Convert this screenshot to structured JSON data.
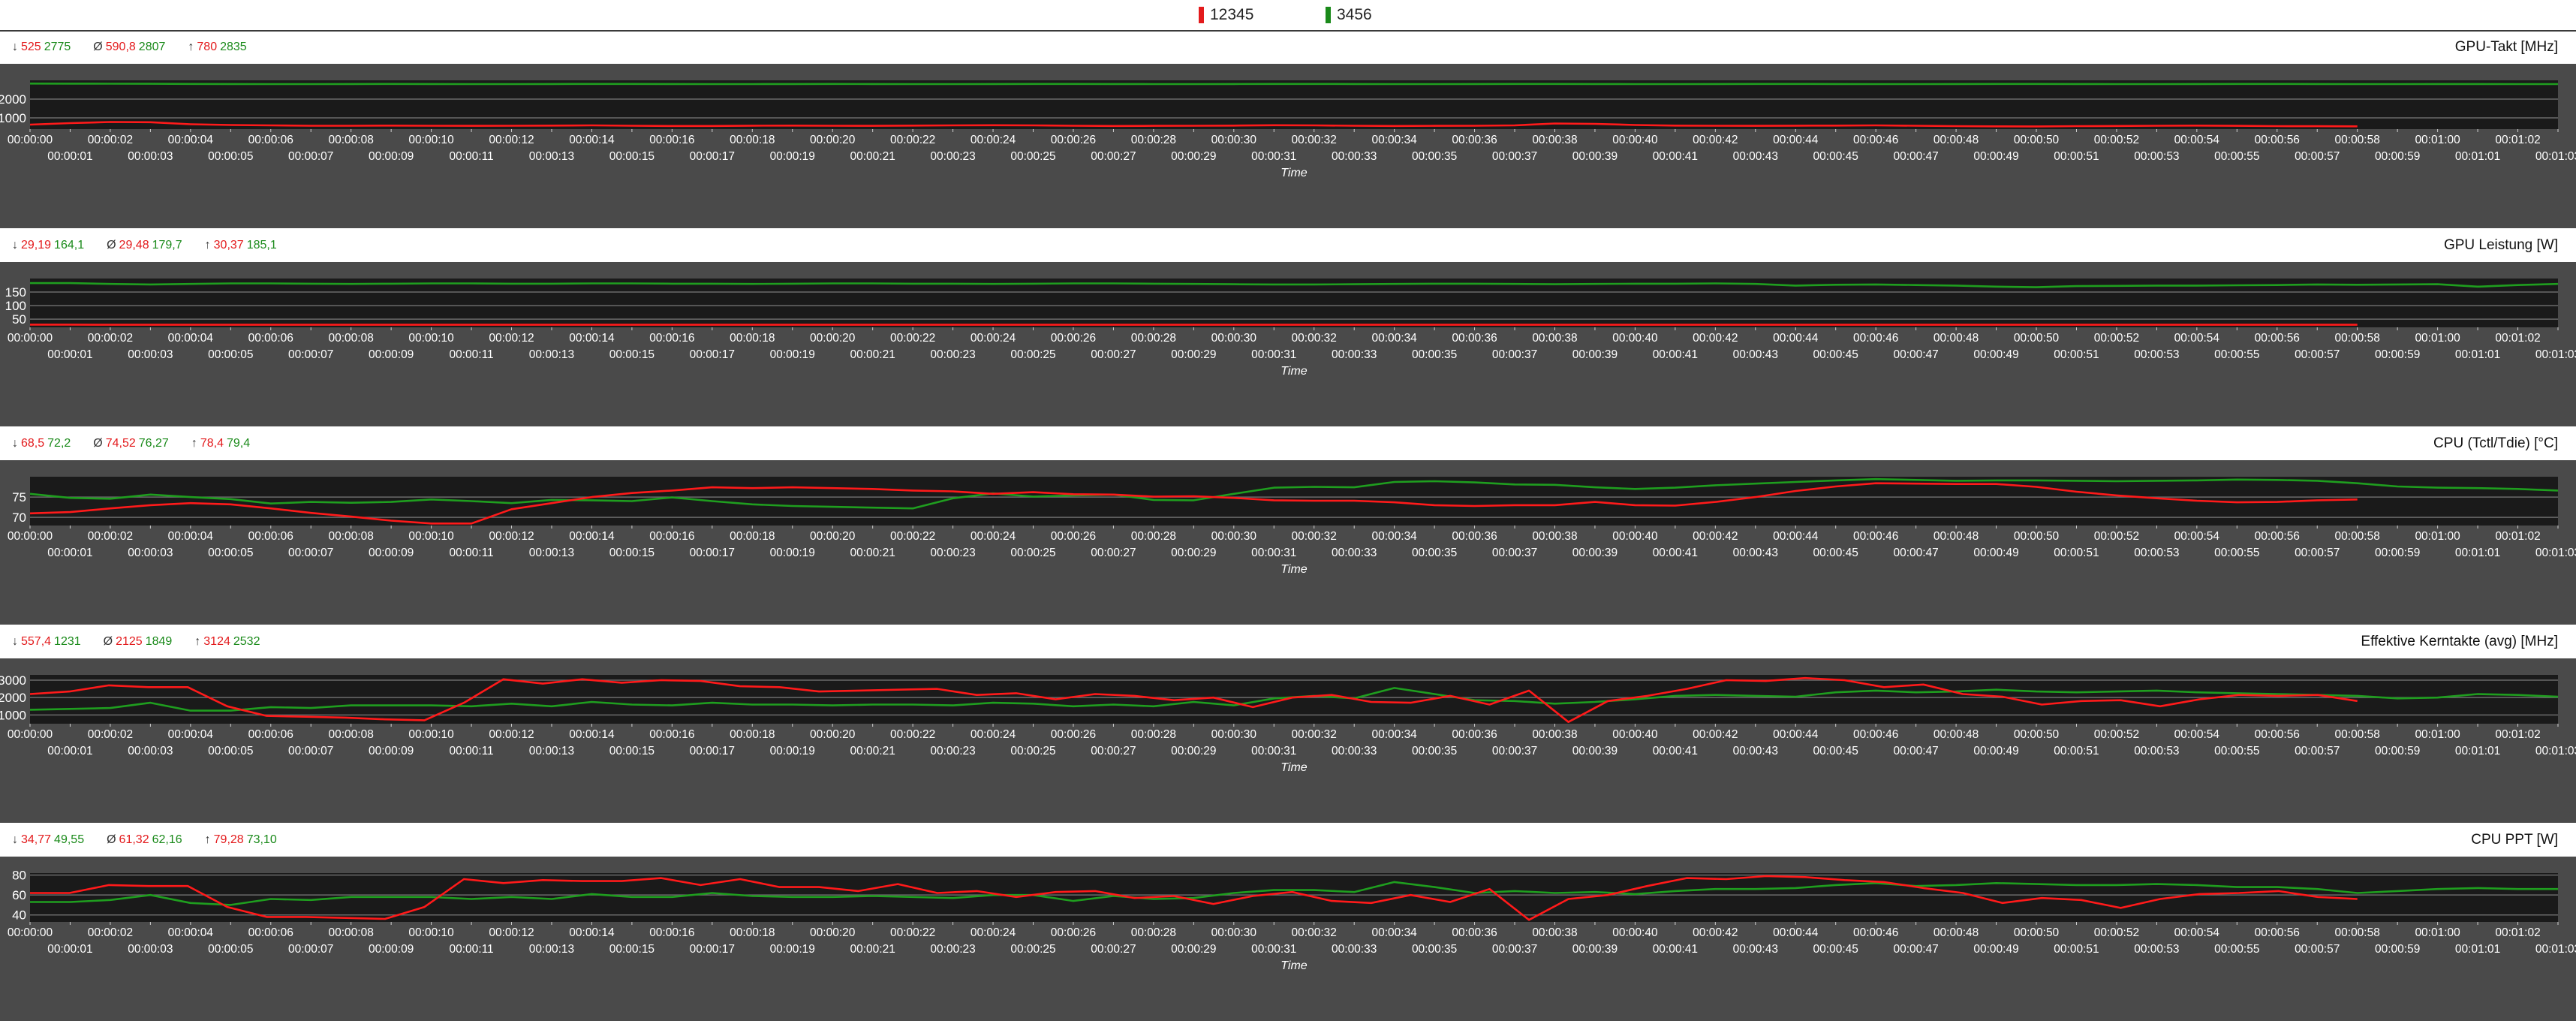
{
  "legend": [
    {
      "label": "12345",
      "color": "#e31a1c"
    },
    {
      "label": "3456",
      "color": "#1a8a1a"
    }
  ],
  "colors": {
    "red": "#ff1a1a",
    "green": "#1f9e1f",
    "plot_bg": "#1a1a1a",
    "frame": "#4a4a4a",
    "grid": "#6a6a6a"
  },
  "time_axis_label": "Time",
  "charts": [
    {
      "title": "GPU-Takt [MHz]",
      "stats": {
        "min": [
          "525",
          "2775"
        ],
        "avg": [
          "590,8",
          "2807"
        ],
        "max": [
          "780",
          "2835"
        ]
      },
      "chart_data": {
        "type": "line",
        "title": "GPU-Takt [MHz]",
        "xlabel": "Time",
        "ylabel": "",
        "ylim": [
          400,
          3000
        ],
        "yticks": [
          1000,
          2000
        ],
        "x_range_s": [
          0,
          63
        ],
        "grid": true,
        "series": [
          {
            "name": "12345",
            "end_s": 58,
            "values": [
              640,
              720,
              780,
              770,
              660,
              620,
              600,
              580,
              580,
              590,
              580,
              575,
              580,
              590,
              600,
              580,
              570,
              570,
              585,
              590,
              580,
              575,
              590,
              600,
              610,
              600,
              580,
              570,
              575,
              580,
              590,
              610,
              600,
              580,
              570,
              575,
              580,
              600,
              700,
              680,
              620,
              590,
              580,
              575,
              585,
              590,
              600,
              580,
              560,
              550,
              545,
              560,
              570,
              580,
              590,
              575,
              560,
              555,
              550
            ]
          },
          {
            "name": "3456",
            "end_s": 63,
            "values": [
              2830,
              2825,
              2820,
              2815,
              2810,
              2805,
              2800,
              2800,
              2805,
              2810,
              2805,
              2800,
              2800,
              2805,
              2810,
              2808,
              2805,
              2800,
              2800,
              2805,
              2810,
              2805,
              2800,
              2800,
              2805,
              2810,
              2808,
              2805,
              2800,
              2800,
              2805,
              2808,
              2810,
              2805,
              2800,
              2800,
              2805,
              2810,
              2810,
              2805,
              2800,
              2800,
              2805,
              2810,
              2808,
              2805,
              2800,
              2800,
              2805,
              2810,
              2808,
              2805,
              2800,
              2800,
              2805,
              2808,
              2810,
              2805,
              2800,
              2800,
              2805,
              2805,
              2800,
              2800
            ]
          }
        ]
      }
    },
    {
      "title": "GPU Leistung [W]",
      "stats": {
        "min": [
          "29,19",
          "164,1"
        ],
        "avg": [
          "29,48",
          "179,7"
        ],
        "max": [
          "30,37",
          "185,1"
        ]
      },
      "chart_data": {
        "type": "line",
        "title": "GPU Leistung [W]",
        "xlabel": "Time",
        "ylabel": "",
        "ylim": [
          20,
          200
        ],
        "yticks": [
          50,
          100,
          150
        ],
        "x_range_s": [
          0,
          63
        ],
        "grid": true,
        "series": [
          {
            "name": "12345",
            "end_s": 58,
            "values": [
              30,
              30,
              29.5,
              29.5,
              29.4,
              29.4,
              29.4,
              29.5,
              29.5,
              29.4,
              29.4,
              29.4,
              29.5,
              29.5,
              29.4,
              29.4,
              29.4,
              29.5,
              29.5,
              29.4,
              29.4,
              29.4,
              29.5,
              29.5,
              29.4,
              29.4,
              29.4,
              29.5,
              29.5,
              29.4,
              29.4,
              29.4,
              29.5,
              29.5,
              29.4,
              29.4,
              29.4,
              29.5,
              29.5,
              29.4,
              29.4,
              29.4,
              29.5,
              29.5,
              29.4,
              29.4,
              29.4,
              29.5,
              29.5,
              29.4,
              29.4,
              29.4,
              29.5,
              29.5,
              29.4,
              29.4,
              29.4,
              29.5,
              29.5
            ]
          },
          {
            "name": "3456",
            "end_s": 63,
            "values": [
              183,
              183,
              180,
              178,
              180,
              182,
              182,
              181,
              180,
              181,
              182,
              182,
              181,
              181,
              182,
              182,
              181,
              181,
              180,
              181,
              182,
              182,
              181,
              181,
              180,
              181,
              182,
              182,
              181,
              180,
              179,
              178,
              178,
              179,
              180,
              181,
              181,
              180,
              179,
              180,
              181,
              181,
              182,
              180,
              174,
              177,
              178,
              176,
              174,
              170,
              168,
              172,
              173,
              174,
              174,
              175,
              176,
              178,
              177,
              178,
              179,
              170,
              176,
              180
            ]
          }
        ]
      }
    },
    {
      "title": "CPU (Tctl/Tdie) [°C]",
      "stats": {
        "min": [
          "68,5",
          "72,2"
        ],
        "avg": [
          "74,52",
          "76,27"
        ],
        "max": [
          "78,4",
          "79,4"
        ]
      },
      "chart_data": {
        "type": "line",
        "title": "CPU (Tctl/Tdie) [°C]",
        "xlabel": "Time",
        "ylabel": "",
        "ylim": [
          68,
          80
        ],
        "yticks": [
          70,
          75
        ],
        "x_range_s": [
          0,
          63
        ],
        "grid": true,
        "series": [
          {
            "name": "12345",
            "end_s": 58,
            "values": [
              71,
              71.3,
              72.2,
              73,
              73.5,
              73.2,
              72.2,
              71.1,
              70.2,
              69.2,
              68.5,
              68.5,
              72,
              73.5,
              75,
              76,
              76.6,
              77.4,
              77.2,
              77.4,
              77.2,
              77,
              76.6,
              76.4,
              75.8,
              76.2,
              75.7,
              75.6,
              75.1,
              75.2,
              74.8,
              74.2,
              74.1,
              74.1,
              73.7,
              73,
              72.8,
              73,
              73,
              73.8,
              73,
              72.9,
              73.8,
              75,
              76.5,
              77.6,
              78.4,
              78.3,
              78.2,
              78.2,
              77.5,
              76.3,
              75.4,
              74.7,
              74.1,
              73.7,
              73.8,
              74.2,
              74.4
            ]
          },
          {
            "name": "3456",
            "end_s": 63,
            "values": [
              75.8,
              74.8,
              74.6,
              75.6,
              75,
              74.5,
              73.4,
              73.8,
              73.6,
              73.8,
              74.4,
              74,
              73.5,
              74.3,
              74.2,
              74,
              74.9,
              74,
              73.2,
              72.8,
              72.6,
              72.4,
              72.2,
              74.7,
              75.9,
              75.1,
              75.4,
              75.6,
              74.3,
              74.2,
              75.8,
              77.3,
              77.5,
              77.4,
              78.7,
              78.9,
              78.6,
              78.1,
              78,
              77.4,
              77,
              77.3,
              77.9,
              78.3,
              78.7,
              79.1,
              79.4,
              79.2,
              79,
              79.1,
              79.1,
              79,
              78.9,
              79,
              79.1,
              79.3,
              79.2,
              79,
              78.4,
              77.6,
              77.3,
              77.2,
              77,
              76.6
            ]
          }
        ]
      }
    },
    {
      "title": "Effektive Kerntakte (avg) [MHz]",
      "stats": {
        "min": [
          "557,4",
          "1231"
        ],
        "avg": [
          "2125",
          "1849"
        ],
        "max": [
          "3124",
          "2532"
        ]
      },
      "chart_data": {
        "type": "line",
        "title": "Effektive Kerntakte (avg) [MHz]",
        "xlabel": "Time",
        "ylabel": "",
        "ylim": [
          500,
          3300
        ],
        "yticks": [
          1000,
          2000,
          3000
        ],
        "x_range_s": [
          0,
          63
        ],
        "grid": true,
        "series": [
          {
            "name": "12345",
            "end_s": 58,
            "values": [
              2200,
              2350,
              2700,
              2600,
              2600,
              1500,
              950,
              900,
              850,
              750,
              700,
              1700,
              3050,
              2800,
              3050,
              2850,
              3000,
              2950,
              2650,
              2600,
              2350,
              2400,
              2450,
              2500,
              2150,
              2250,
              1900,
              2200,
              2100,
              1850,
              2000,
              1450,
              2000,
              2150,
              1750,
              1700,
              2100,
              1600,
              2400,
              600,
              1800,
              2100,
              2500,
              3000,
              2950,
              3120,
              3000,
              2600,
              2750,
              2200,
              2050,
              1600,
              1800,
              1850,
              1500,
              1900,
              2150,
              2100,
              2150,
              1800
            ]
          },
          {
            "name": "3456",
            "end_s": 63,
            "values": [
              1300,
              1350,
              1400,
              1700,
              1250,
              1250,
              1450,
              1400,
              1550,
              1550,
              1550,
              1500,
              1650,
              1500,
              1750,
              1600,
              1550,
              1700,
              1600,
              1600,
              1550,
              1600,
              1600,
              1550,
              1700,
              1650,
              1500,
              1600,
              1500,
              1750,
              1550,
              1950,
              2100,
              1950,
              2550,
              2200,
              1850,
              1800,
              1650,
              1750,
              1900,
              2100,
              2150,
              2100,
              2050,
              2300,
              2400,
              2300,
              2350,
              2450,
              2350,
              2300,
              2350,
              2400,
              2300,
              2250,
              2200,
              2150,
              2100,
              1950,
              2000,
              2200,
              2150,
              2050
            ]
          }
        ]
      }
    },
    {
      "title": "CPU PPT [W]",
      "stats": {
        "min": [
          "34,77",
          "49,55"
        ],
        "avg": [
          "61,32",
          "62,16"
        ],
        "max": [
          "79,28",
          "73,10"
        ]
      },
      "chart_data": {
        "type": "line",
        "title": "CPU PPT [W]",
        "xlabel": "Time",
        "ylabel": "",
        "ylim": [
          33,
          82
        ],
        "yticks": [
          40,
          60,
          80
        ],
        "x_range_s": [
          0,
          63
        ],
        "grid": true,
        "series": [
          {
            "name": "12345",
            "end_s": 58,
            "values": [
              62,
              62,
              70,
              69,
              69,
              48,
              38,
              38,
              37,
              36,
              48,
              76,
              72,
              75,
              74,
              74,
              77,
              70,
              76,
              68,
              68,
              64,
              71,
              62,
              64,
              58,
              63,
              64,
              57,
              59,
              51,
              59,
              63,
              54,
              52,
              60,
              53,
              66,
              35,
              56,
              60,
              69,
              77,
              76,
              79,
              78,
              75,
              73,
              67,
              62,
              52,
              57,
              55,
              47,
              56,
              61,
              62,
              64,
              58,
              56
            ]
          },
          {
            "name": "3456",
            "end_s": 63,
            "values": [
              53,
              53,
              55,
              60,
              52,
              50,
              56,
              55,
              58,
              58,
              58,
              56,
              58,
              56,
              61,
              58,
              58,
              62,
              59,
              58,
              58,
              59,
              58,
              57,
              60,
              60,
              54,
              59,
              56,
              57,
              62,
              65,
              65,
              63,
              73,
              68,
              62,
              64,
              62,
              63,
              61,
              64,
              66,
              66,
              67,
              70,
              72,
              69,
              70,
              72,
              71,
              70,
              70,
              71,
              70,
              68,
              68,
              66,
              62,
              64,
              66,
              67,
              66,
              66
            ]
          }
        ]
      }
    }
  ]
}
